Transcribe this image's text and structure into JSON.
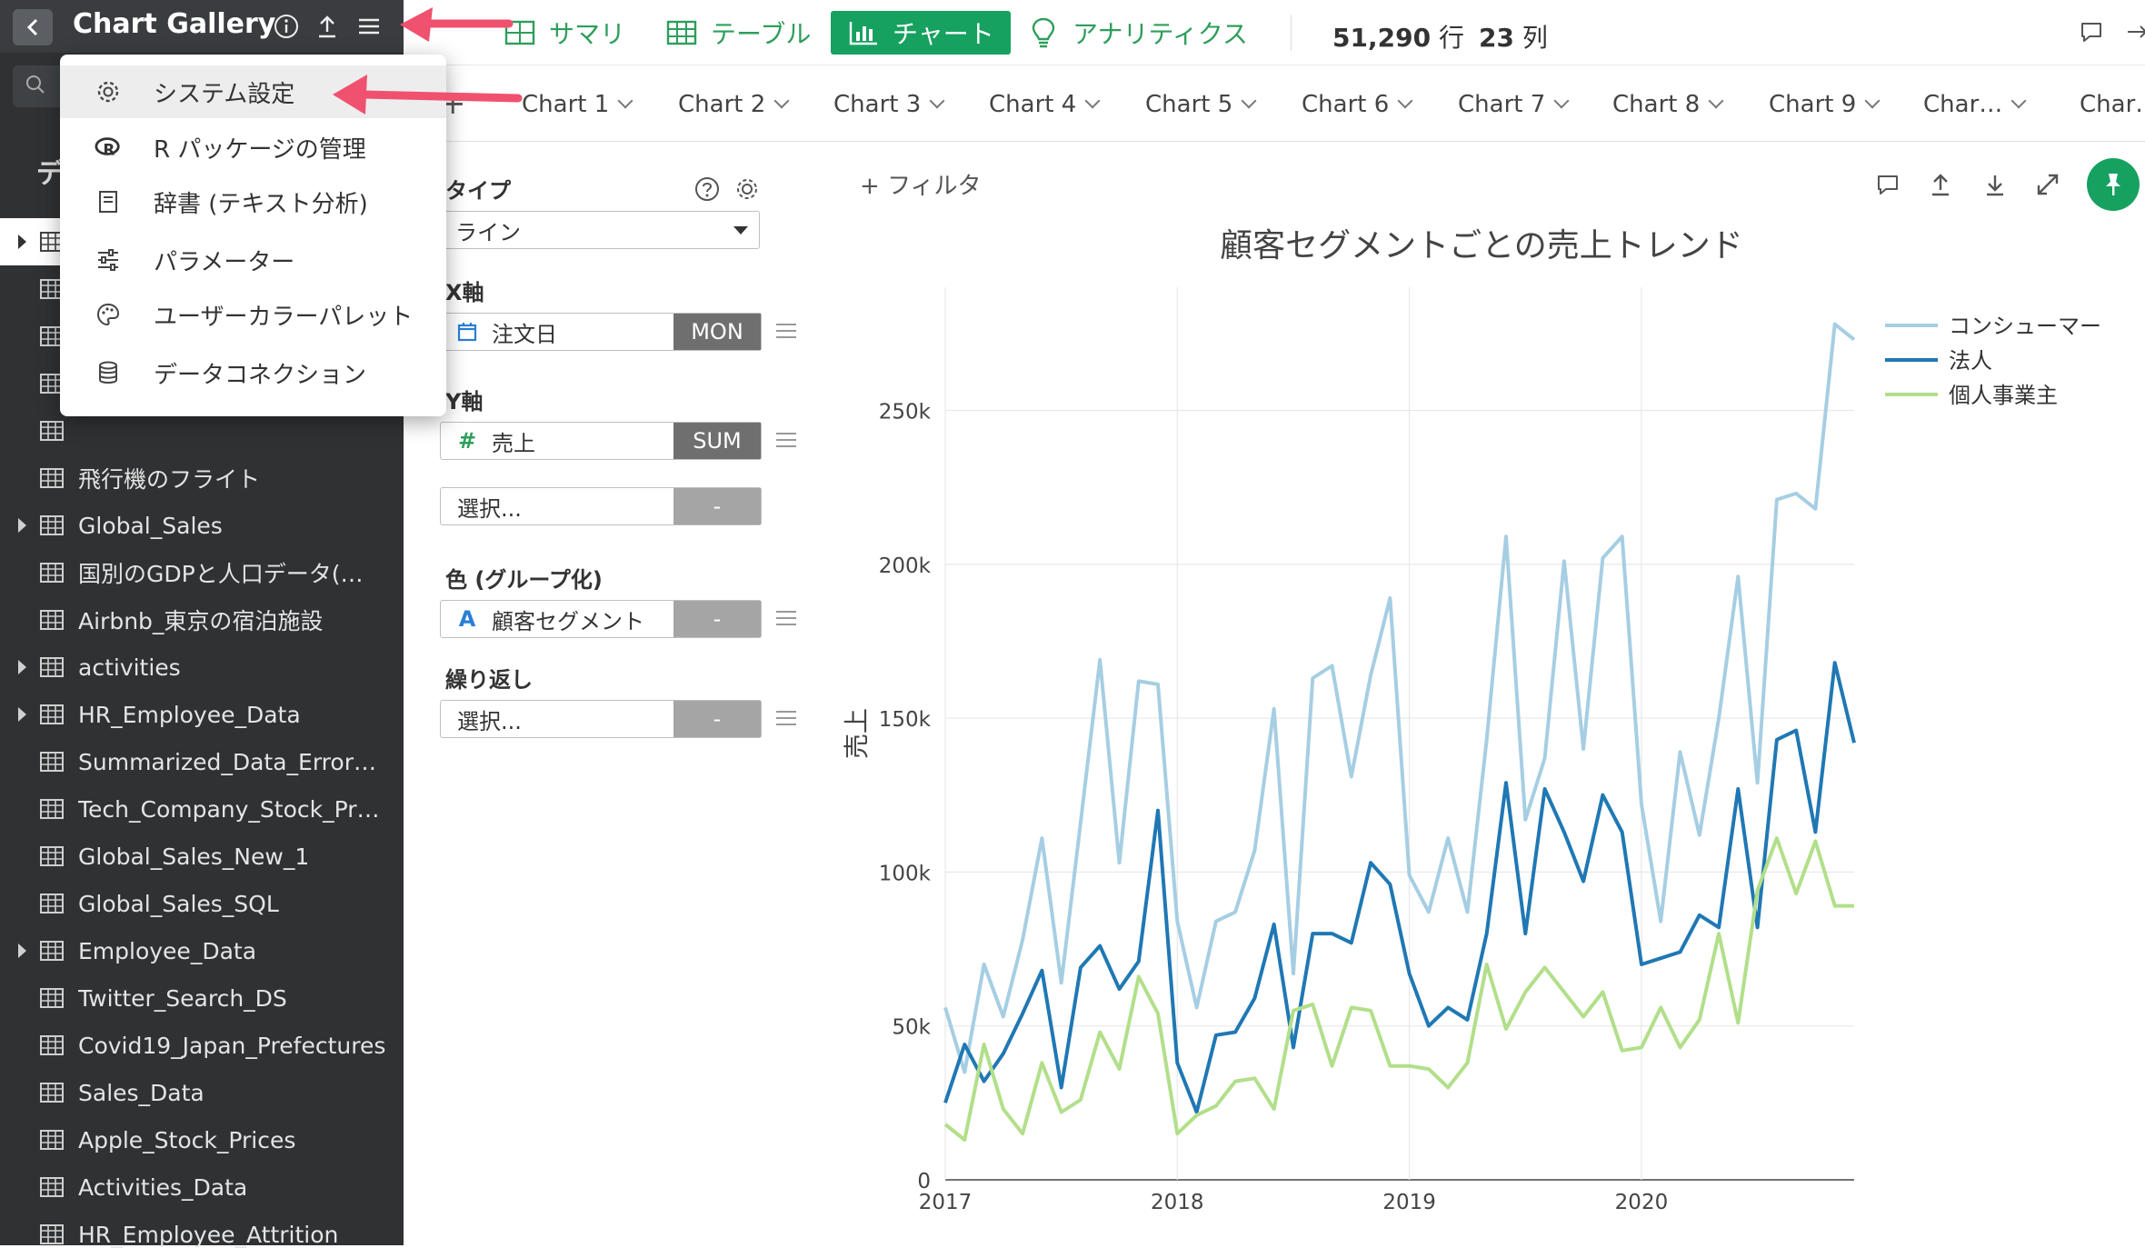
{
  "app": {
    "title": "Chart Gallery"
  },
  "sidebar": {
    "section_label": "デ",
    "items": [
      {
        "label": "",
        "caret": true,
        "selected": true
      },
      {
        "label": "",
        "caret": false
      },
      {
        "label": "",
        "caret": false
      },
      {
        "label": "",
        "caret": false
      },
      {
        "label": "",
        "caret": false
      },
      {
        "label": "飛行機のフライト",
        "caret": false
      },
      {
        "label": "Global_Sales",
        "caret": true
      },
      {
        "label": "国別のGDPと人口データ(…",
        "caret": false
      },
      {
        "label": "Airbnb_東京の宿泊施設",
        "caret": false
      },
      {
        "label": "activities",
        "caret": true
      },
      {
        "label": "HR_Employee_Data",
        "caret": true
      },
      {
        "label": "Summarized_Data_Error_…",
        "caret": false
      },
      {
        "label": "Tech_Company_Stock_Pr…",
        "caret": false
      },
      {
        "label": "Global_Sales_New_1",
        "caret": false
      },
      {
        "label": "Global_Sales_SQL",
        "caret": false
      },
      {
        "label": "Employee_Data",
        "caret": true
      },
      {
        "label": "Twitter_Search_DS",
        "caret": false
      },
      {
        "label": "Covid19_Japan_Prefectures",
        "caret": false
      },
      {
        "label": "Sales_Data",
        "caret": false
      },
      {
        "label": "Apple_Stock_Prices",
        "caret": false
      },
      {
        "label": "Activities_Data",
        "caret": false
      },
      {
        "label": "HR_Employee_Attrition",
        "caret": false
      }
    ]
  },
  "menu": {
    "items": [
      {
        "label": "システム設定",
        "icon": "gear-icon"
      },
      {
        "label": "R パッケージの管理",
        "icon": "r-logo-icon"
      },
      {
        "label": "辞書 (テキスト分析)",
        "icon": "book-icon"
      },
      {
        "label": "パラメーター",
        "icon": "sliders-icon"
      },
      {
        "label": "ユーザーカラーパレット",
        "icon": "palette-icon"
      },
      {
        "label": "データコネクション",
        "icon": "database-icon"
      }
    ]
  },
  "topbar": {
    "summary": "サマリ",
    "table": "テーブル",
    "chart": "チャート",
    "analytics": "アナリティクス",
    "rows_count": "51,290",
    "rows_unit": "行",
    "cols_count": "23",
    "cols_unit": "列"
  },
  "tabs": [
    "Chart 1",
    "Chart 2",
    "Chart 3",
    "Chart 4",
    "Chart 5",
    "Chart 6",
    "Chart 7",
    "Chart 8",
    "Chart 9",
    "Char…",
    "Char…"
  ],
  "config": {
    "type_label": "タイプ",
    "type_value": "ライン",
    "x_label": "X軸",
    "x_field": "注文日",
    "x_agg": "MON",
    "y_label": "Y軸",
    "y_field": "売上",
    "y_agg": "SUM",
    "y2_placeholder": "選択...",
    "y2_agg": "-",
    "color_label": "色 (グループ化)",
    "color_field": "顧客セグメント",
    "color_agg": "-",
    "repeat_label": "繰り返し",
    "repeat_placeholder": "選択...",
    "repeat_agg": "-"
  },
  "chart_area": {
    "filter_label": "フィルタ",
    "accent": "#17a160"
  },
  "chart_data": {
    "type": "line",
    "title": "顧客セグメントごとの売上トレンド",
    "xlabel": "",
    "ylabel": "売上",
    "x_ticks": [
      "2017",
      "2018",
      "2019",
      "2020"
    ],
    "y_ticks": [
      "0",
      "50k",
      "100k",
      "150k",
      "200k",
      "250k"
    ],
    "ylim": [
      0,
      290000
    ],
    "x": [
      "2017-01",
      "2017-02",
      "2017-03",
      "2017-04",
      "2017-05",
      "2017-06",
      "2017-07",
      "2017-08",
      "2017-09",
      "2017-10",
      "2017-11",
      "2017-12",
      "2018-01",
      "2018-02",
      "2018-03",
      "2018-04",
      "2018-05",
      "2018-06",
      "2018-07",
      "2018-08",
      "2018-09",
      "2018-10",
      "2018-11",
      "2018-12",
      "2019-01",
      "2019-02",
      "2019-03",
      "2019-04",
      "2019-05",
      "2019-06",
      "2019-07",
      "2019-08",
      "2019-09",
      "2019-10",
      "2019-11",
      "2019-12",
      "2020-01",
      "2020-02",
      "2020-03",
      "2020-04",
      "2020-05",
      "2020-06",
      "2020-07",
      "2020-08",
      "2020-09",
      "2020-10",
      "2020-11",
      "2020-12"
    ],
    "grid": true,
    "legend_position": "right",
    "series": [
      {
        "name": "コンシューマー",
        "color": "#a6cee3",
        "values": [
          56000,
          35000,
          70000,
          53000,
          78000,
          111000,
          64000,
          116000,
          169000,
          103000,
          162000,
          161000,
          84000,
          56000,
          84000,
          87000,
          107000,
          153000,
          67000,
          163000,
          167000,
          131000,
          164000,
          189000,
          99000,
          87000,
          111000,
          87000,
          143000,
          209000,
          117000,
          137000,
          201000,
          140000,
          202000,
          209000,
          122000,
          84000,
          139000,
          112000,
          150000,
          196000,
          129000,
          221000,
          223000,
          218000,
          278000,
          273000
        ]
      },
      {
        "name": "法人",
        "color": "#1f78b4",
        "values": [
          25000,
          44000,
          32000,
          41000,
          54000,
          68000,
          30000,
          69000,
          76000,
          62000,
          71000,
          120000,
          38000,
          22000,
          47000,
          48000,
          59000,
          83000,
          43000,
          80000,
          80000,
          77000,
          103000,
          96000,
          67000,
          50000,
          56000,
          52000,
          80000,
          129000,
          80000,
          127000,
          113000,
          97000,
          125000,
          113000,
          70000,
          72000,
          74000,
          86000,
          82000,
          127000,
          82000,
          143000,
          146000,
          113000,
          168000,
          142000
        ]
      },
      {
        "name": "個人事業主",
        "color": "#b2df8a",
        "values": [
          18000,
          13000,
          44000,
          23000,
          15000,
          38000,
          22000,
          26000,
          48000,
          36000,
          66000,
          54000,
          15000,
          21000,
          24000,
          32000,
          33000,
          23000,
          55000,
          57000,
          37000,
          56000,
          55000,
          37000,
          37000,
          36000,
          30000,
          38000,
          70000,
          49000,
          61000,
          69000,
          61000,
          53000,
          61000,
          42000,
          43000,
          56000,
          43000,
          52000,
          80000,
          51000,
          94000,
          111000,
          93000,
          110000,
          89000,
          89000
        ]
      }
    ]
  }
}
